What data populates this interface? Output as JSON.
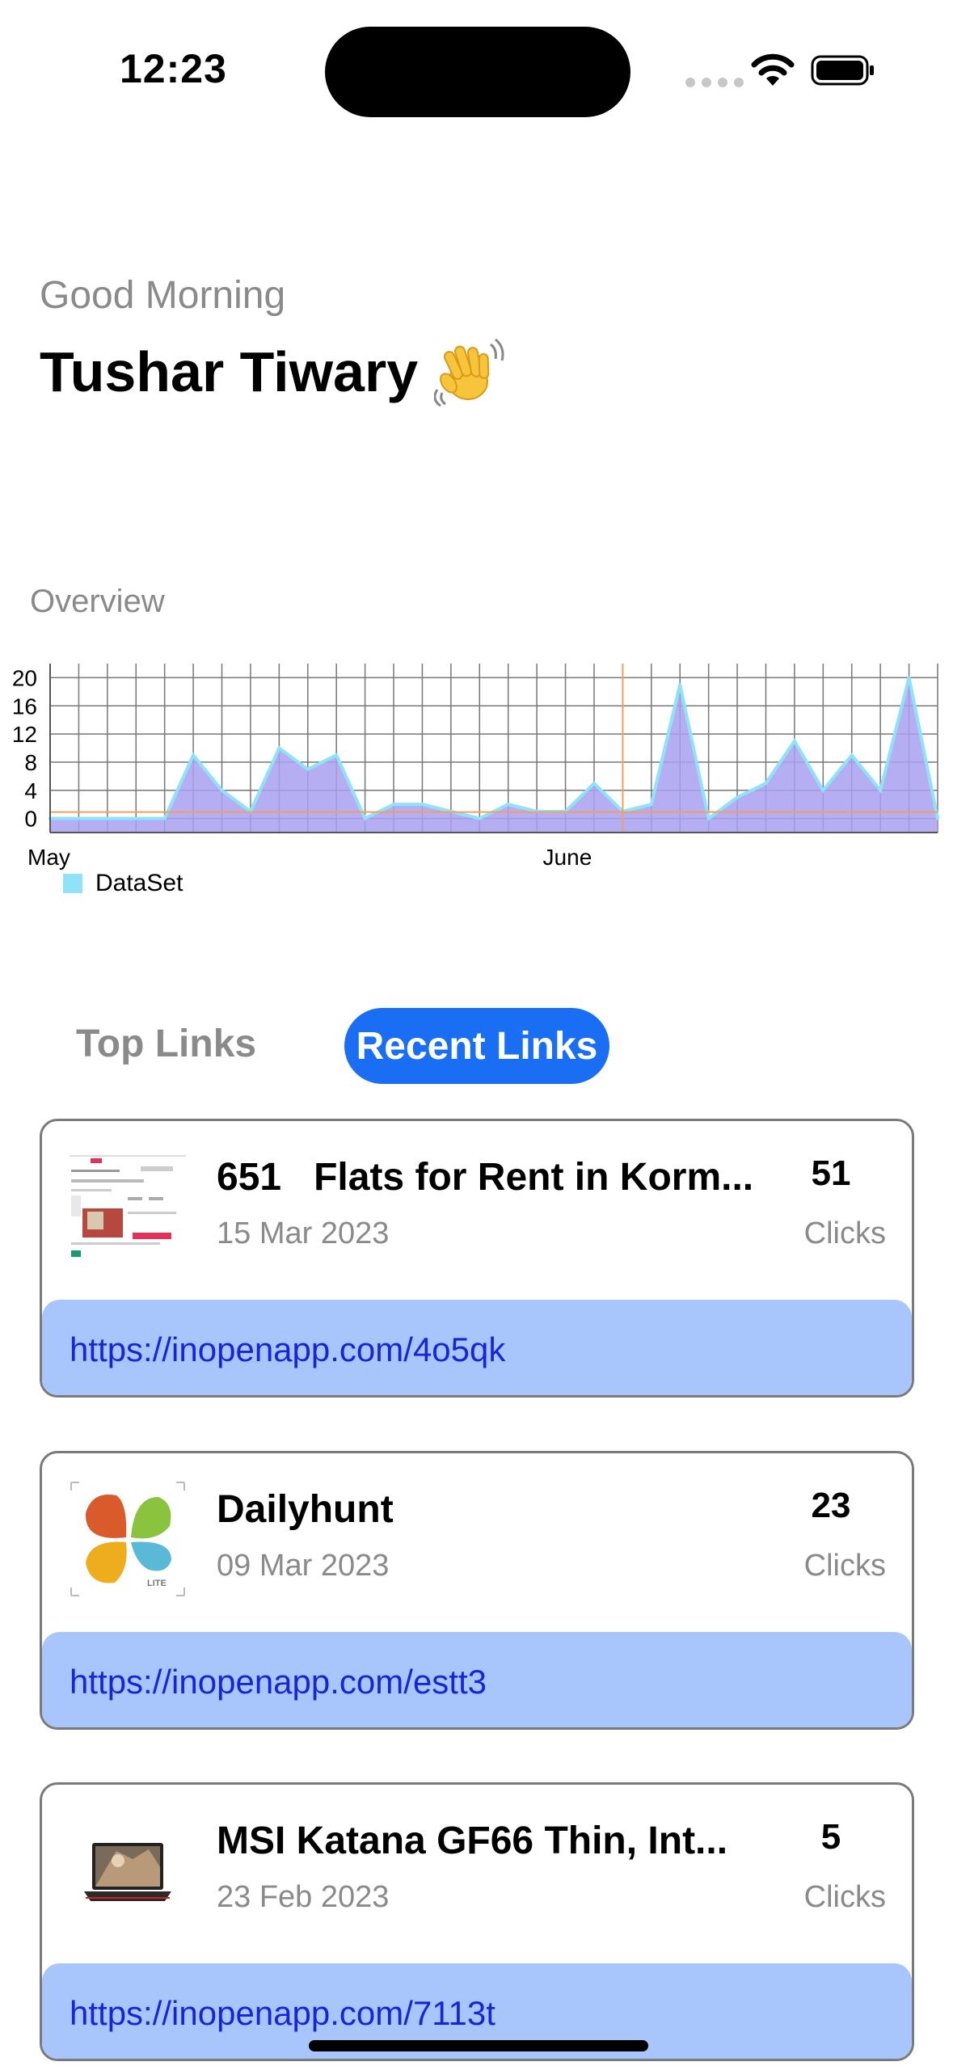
{
  "status": {
    "time": "12:23"
  },
  "greeting": {
    "subtitle": "Good Morning",
    "name": "Tushar Tiwary"
  },
  "overview": {
    "title": "Overview"
  },
  "chart_data": {
    "type": "area",
    "title": "",
    "xlabel": "",
    "ylabel": "",
    "x_tick_labels": [
      "May",
      "June"
    ],
    "y_ticks": [
      "20",
      "16",
      "12",
      "8",
      "4",
      "0"
    ],
    "ylim": [
      -2,
      22
    ],
    "grid": true,
    "legend_position": "bottom-left",
    "series": [
      {
        "name": "DataSet",
        "color": "#8fe2f7",
        "fill": "#a8a0f0",
        "values": [
          0,
          0,
          0,
          0,
          0,
          9,
          4,
          1,
          10,
          7,
          9,
          0,
          2,
          2,
          1,
          0,
          2,
          1,
          1,
          5,
          1,
          2,
          19,
          0,
          3,
          5,
          11,
          4,
          9,
          4,
          20,
          0
        ]
      }
    ]
  },
  "tabs": {
    "top": "Top Links",
    "recent": "Recent Links"
  },
  "links": [
    {
      "title": "651   Flats for Rent in Korm...",
      "date": "15 Mar 2023",
      "count": "51",
      "clicks_label": "Clicks",
      "url": "https://inopenapp.com/4o5qk"
    },
    {
      "title": "Dailyhunt",
      "date": "09 Mar 2023",
      "count": "23",
      "clicks_label": "Clicks",
      "url": "https://inopenapp.com/estt3"
    },
    {
      "title": "MSI Katana GF66 Thin, Int...",
      "date": "23 Feb 2023",
      "count": "5",
      "clicks_label": "Clicks",
      "url": "https://inopenapp.com/7113t"
    }
  ]
}
